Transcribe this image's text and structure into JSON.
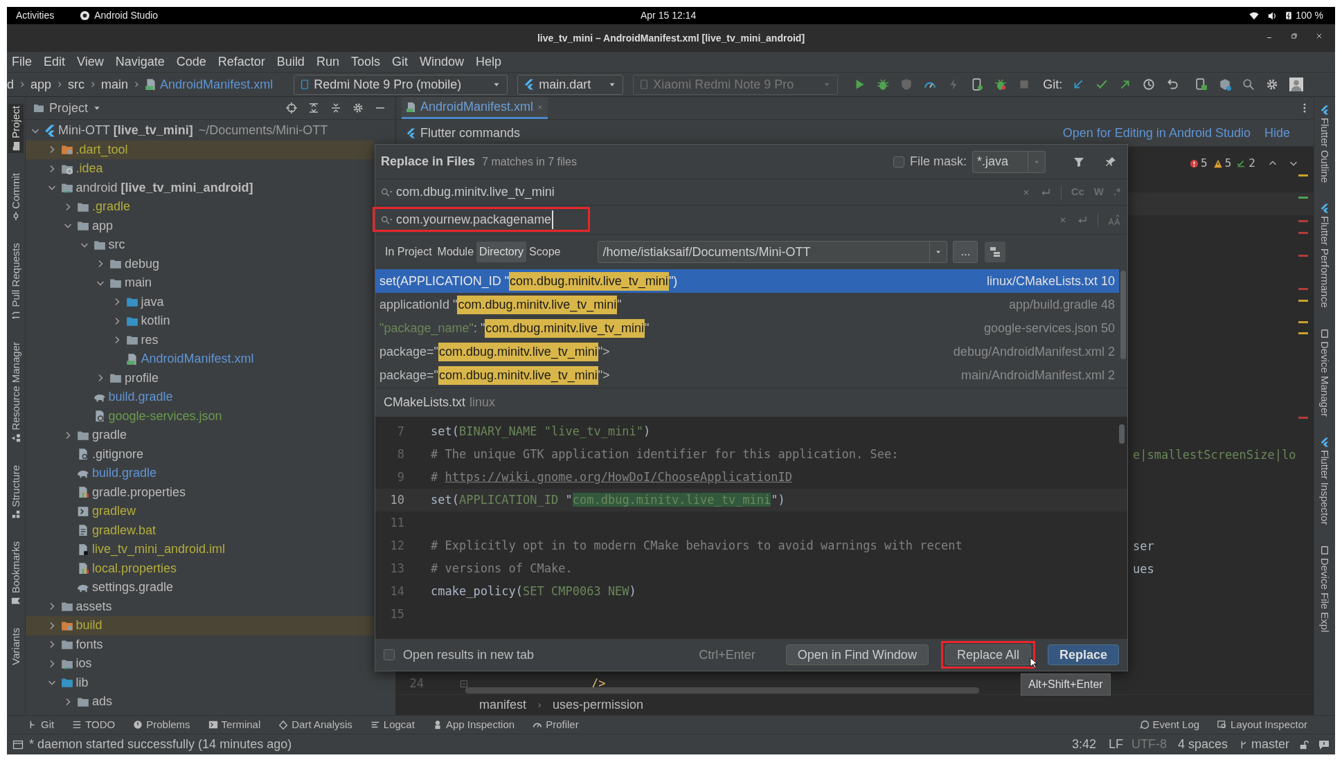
{
  "system_bar": {
    "activities": "Activities",
    "app": "Android Studio",
    "clock": "Apr 15  12:14",
    "battery": "100 %"
  },
  "window": {
    "title": "live_tv_mini – AndroidManifest.xml [live_tv_mini_android]"
  },
  "menu": [
    "File",
    "Edit",
    "View",
    "Navigate",
    "Code",
    "Refactor",
    "Build",
    "Run",
    "Tools",
    "Git",
    "Window",
    "Help"
  ],
  "navigation_bar": {
    "breadcrumbs": [
      "d",
      "app",
      "src",
      "main",
      "AndroidManifest.xml"
    ],
    "device": "Redmi Note 9 Pro (mobile)",
    "run_config": "main.dart",
    "target": "Xiaomi Redmi Note 9 Pro",
    "git_label": "Git:"
  },
  "left_stripe": [
    {
      "label": "Project",
      "selected": true
    },
    {
      "label": "Commit",
      "selected": false
    },
    {
      "label": "Pull Requests",
      "selected": false
    },
    {
      "label": "Resource Manager",
      "selected": false
    },
    {
      "label": "Structure",
      "selected": false
    },
    {
      "label": "Bookmarks",
      "selected": false
    },
    {
      "label": "Variants",
      "selected": false
    }
  ],
  "right_stripe": [
    "Flutter Outline",
    "Flutter Performance",
    "Device Manager",
    "Flutter Inspector",
    "Device File Expl"
  ],
  "project": {
    "title": "Project",
    "tree": [
      {
        "kind": "project-root",
        "label": "Mini-OTT **[live_tv_mini]**",
        "path": "~/Documents/Mini-OTT",
        "color": "#bbbbbb",
        "ignored": false,
        "expanded": true,
        "children": [
          {
            "kind": "excluded-folder",
            "label": ".dart_tool",
            "color": "#b3ad3c",
            "ignored": true,
            "expanded": false
          },
          {
            "kind": "config-folder",
            "label": ".idea",
            "color": "#b3ad3c",
            "ignored": false,
            "expanded": false
          },
          {
            "kind": "module-folder",
            "label": "android **[live_tv_mini_android]**",
            "color": "#bbbbbb",
            "ignored": false,
            "expanded": true,
            "children": [
              {
                "kind": "folder",
                "label": ".gradle",
                "color": "#b3ad3c",
                "ignored": false,
                "expanded": false
              },
              {
                "kind": "folder",
                "label": "app",
                "color": "#bbbbbb",
                "ignored": false,
                "expanded": true,
                "children": [
                  {
                    "kind": "folder",
                    "label": "src",
                    "color": "#bbbbbb",
                    "ignored": false,
                    "expanded": true,
                    "children": [
                      {
                        "kind": "folder",
                        "label": "debug",
                        "color": "#bbbbbb",
                        "ignored": false,
                        "expanded": false
                      },
                      {
                        "kind": "folder",
                        "label": "main",
                        "color": "#bbbbbb",
                        "ignored": false,
                        "expanded": true,
                        "children": [
                          {
                            "kind": "source-folder",
                            "label": "java",
                            "color": "#bbbbbb",
                            "ignored": false,
                            "expanded": false
                          },
                          {
                            "kind": "source-folder",
                            "label": "kotlin",
                            "color": "#bbbbbb",
                            "ignored": false,
                            "expanded": false
                          },
                          {
                            "kind": "folder",
                            "label": "res",
                            "color": "#bbbbbb",
                            "ignored": false,
                            "expanded": false
                          },
                          {
                            "kind": "manifest",
                            "label": "AndroidManifest.xml",
                            "color": "#5f95d6",
                            "ignored": false
                          }
                        ]
                      },
                      {
                        "kind": "folder",
                        "label": "profile",
                        "color": "#bbbbbb",
                        "ignored": false,
                        "expanded": false
                      }
                    ]
                  },
                  {
                    "kind": "gradle",
                    "label": "build.gradle",
                    "color": "#5f95d6",
                    "ignored": false
                  },
                  {
                    "kind": "json",
                    "label": "google-services.json",
                    "color": "#6a9a4c",
                    "ignored": false
                  }
                ]
              },
              {
                "kind": "folder",
                "label": "gradle",
                "color": "#bbbbbb",
                "ignored": false,
                "expanded": false
              },
              {
                "kind": "gitignore",
                "label": ".gitignore",
                "color": "#bbbbbb",
                "ignored": false
              },
              {
                "kind": "gradle",
                "label": "build.gradle",
                "color": "#5f95d6",
                "ignored": false
              },
              {
                "kind": "properties",
                "label": "gradle.properties",
                "color": "#bbbbbb",
                "ignored": false
              },
              {
                "kind": "script",
                "label": "gradlew",
                "color": "#b3ad3c",
                "ignored": false
              },
              {
                "kind": "text",
                "label": "gradlew.bat",
                "color": "#b3ad3c",
                "ignored": false
              },
              {
                "kind": "iml",
                "label": "live_tv_mini_android.iml",
                "color": "#b3ad3c",
                "ignored": false
              },
              {
                "kind": "properties",
                "label": "local.properties",
                "color": "#b3ad3c",
                "ignored": false
              },
              {
                "kind": "gradle",
                "label": "settings.gradle",
                "color": "#bbbbbb",
                "ignored": false
              }
            ]
          },
          {
            "kind": "folder",
            "label": "assets",
            "color": "#bbbbbb",
            "ignored": false,
            "expanded": false
          },
          {
            "kind": "excluded-folder",
            "label": "build",
            "color": "#b3ad3c",
            "ignored": true,
            "expanded": false
          },
          {
            "kind": "folder",
            "label": "fonts",
            "color": "#bbbbbb",
            "ignored": false,
            "expanded": false
          },
          {
            "kind": "module-folder",
            "label": "ios",
            "color": "#bbbbbb",
            "ignored": false,
            "expanded": false
          },
          {
            "kind": "source-folder",
            "label": "lib",
            "color": "#bbbbbb",
            "ignored": false,
            "expanded": true,
            "children": [
              {
                "kind": "folder",
                "label": "ads",
                "color": "#bbbbbb",
                "ignored": false,
                "expanded": false
              }
            ]
          }
        ]
      }
    ]
  },
  "editor": {
    "tabs": [
      {
        "label": "AndroidManifest.xml",
        "selected": true
      }
    ],
    "banner": {
      "title": "Flutter commands",
      "link": "Open for Editing in Android Studio",
      "hide": "Hide"
    },
    "inspections": {
      "errors": "5",
      "warnings": "5",
      "typos": "2"
    },
    "visible_text": [
      {
        "text": "e|smallestScreenSize|lo",
        "kind": "string"
      },
      {
        "text": "ser",
        "kind": "plain"
      },
      {
        "text": "ues",
        "kind": "plain"
      }
    ],
    "bottom_line": {
      "number": "24",
      "text": "/>"
    },
    "breadcrumbs": [
      "manifest",
      "uses-permission"
    ]
  },
  "dialog": {
    "title": "Replace in Files",
    "summary": "7 matches in 7 files",
    "file_mask": {
      "label": "File mask:",
      "checked": false,
      "value": "*.java"
    },
    "find": {
      "value": "com.dbug.minitv.live_tv_mini",
      "toggles": [
        "Cc",
        "W",
        ".*"
      ]
    },
    "replace": {
      "value": "com.yournew.packagename",
      "highlighted": true
    },
    "scopes": [
      {
        "label": "In Project",
        "selected": false
      },
      {
        "label": "Module",
        "selected": false
      },
      {
        "label": "Directory",
        "selected": true
      },
      {
        "label": "Scope",
        "selected": false
      }
    ],
    "directory": "/home/istiaksaif/Documents/Mini-OTT",
    "browse": "...",
    "results": [
      {
        "prefix": [
          {
            "text": "set(APPLICATION_ID \"",
            "kind": "plain"
          }
        ],
        "match": "com.dbug.minitv.live_tv_mini",
        "suffix": "\")",
        "file": "linux/CMakeLists.txt 10",
        "selected": true
      },
      {
        "prefix": [
          {
            "text": "applicationId \"",
            "kind": "plain"
          }
        ],
        "match": "com.dbug.minitv.live_tv_mini",
        "suffix": "\"",
        "file": "app/build.gradle 48",
        "selected": false
      },
      {
        "prefix": [
          {
            "text": "\"package_name\"",
            "kind": "string"
          },
          {
            "text": ": \"",
            "kind": "plain"
          }
        ],
        "match": "com.dbug.minitv.live_tv_mini",
        "suffix": "\"",
        "file": "google-services.json 50",
        "selected": false
      },
      {
        "prefix": [
          {
            "text": "package=\"",
            "kind": "plain"
          }
        ],
        "match": "com.dbug.minitv.live_tv_mini",
        "suffix": "\">",
        "file": "debug/AndroidManifest.xml 2",
        "selected": false
      },
      {
        "prefix": [
          {
            "text": "package=\"",
            "kind": "plain"
          }
        ],
        "match": "com.dbug.minitv.live_tv_mini",
        "suffix": "\">",
        "file": "main/AndroidManifest.xml 2",
        "selected": false
      }
    ],
    "preview_file": {
      "name": "CMakeLists.txt",
      "folder": "linux"
    },
    "preview_lines": [
      {
        "number": "7",
        "current": false,
        "tokens": [
          {
            "text": "set(",
            "kind": "plain"
          },
          {
            "text": "BINARY_NAME",
            "kind": "constant"
          },
          {
            "text": " \"live_tv_mini\"",
            "kind": "string"
          },
          {
            "text": ")",
            "kind": "plain"
          }
        ]
      },
      {
        "number": "8",
        "current": false,
        "tokens": [
          {
            "text": "# The unique GTK application identifier for this application. See:",
            "kind": "comment"
          }
        ]
      },
      {
        "number": "9",
        "current": false,
        "tokens": [
          {
            "text": "# ",
            "kind": "comment"
          },
          {
            "text": "https://wiki.gnome.org/HowDoI/ChooseApplicationID",
            "kind": "link"
          }
        ]
      },
      {
        "number": "10",
        "current": true,
        "tokens": [
          {
            "text": "set(",
            "kind": "plain"
          },
          {
            "text": "APPLICATION_ID",
            "kind": "constant"
          },
          {
            "text": " \"",
            "kind": "plain"
          },
          {
            "text": "com.dbug.minitv.live_tv_mini",
            "kind": "match"
          },
          {
            "text": "\")",
            "kind": "plain"
          }
        ]
      },
      {
        "number": "11",
        "current": false
      },
      {
        "number": "12",
        "current": false,
        "tokens": [
          {
            "text": "# Explicitly opt in to modern CMake behaviors to avoid warnings with recent",
            "kind": "comment"
          }
        ]
      },
      {
        "number": "13",
        "current": false,
        "tokens": [
          {
            "text": "# versions of CMake.",
            "kind": "comment"
          }
        ]
      },
      {
        "number": "14",
        "current": false,
        "tokens": [
          {
            "text": "cmake_policy(",
            "kind": "plain"
          },
          {
            "text": "SET CMP0063 NEW",
            "kind": "constant"
          },
          {
            "text": ")",
            "kind": "plain"
          }
        ]
      },
      {
        "number": "15",
        "current": false
      }
    ],
    "open_in_new_tab": {
      "label": "Open results in new tab",
      "checked": false
    },
    "shortcut": "Ctrl+Enter",
    "buttons": [
      {
        "label": "Open in Find Window",
        "kind": "normal",
        "highlighted": false
      },
      {
        "label": "Replace All",
        "kind": "normal",
        "highlighted": true
      },
      {
        "label": "Replace",
        "kind": "default",
        "highlighted": false
      }
    ]
  },
  "tooltip": "Alt+Shift+Enter",
  "tool_windows": {
    "left": [
      "Git",
      "TODO",
      "Problems",
      "Terminal",
      "Dart Analysis",
      "Logcat",
      "App Inspection",
      "Profiler"
    ],
    "right": [
      "Event Log",
      "Layout Inspector"
    ]
  },
  "status_bar": {
    "message": "* daemon started successfully (14 minutes ago)",
    "position": "3:42",
    "line_separator": "LF",
    "encoding": "UTF-8",
    "indent": "4 spaces",
    "branch": "master"
  }
}
